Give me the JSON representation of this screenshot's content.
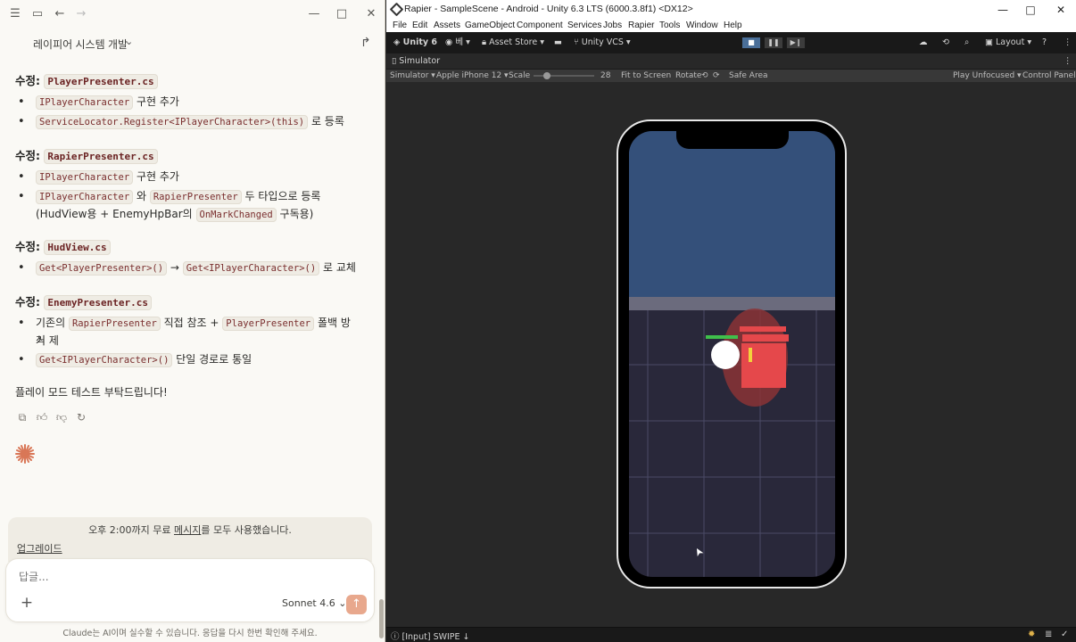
{
  "chat": {
    "title": "레이피어 시스템 개발",
    "sections": [
      {
        "prefix": "수정:",
        "file": "PlayerPresenter.cs",
        "bullets": [
          {
            "c1": "IPlayerCharacter",
            "t1": "구현 추가"
          },
          {
            "c1": "ServiceLocator.Register<IPlayerCharacter>(this)",
            "t1": "로 등록"
          }
        ]
      },
      {
        "prefix": "수정:",
        "file": "RapierPresenter.cs",
        "bullets": [
          {
            "c1": "IPlayerCharacter",
            "t1": "구현 추가"
          },
          {
            "c1": "IPlayerCharacter",
            "t1": "와",
            "c2": "RapierPresenter",
            "t2": "두 타입으로 등록",
            "line2a": "(HudView용 + EnemyHpBar의",
            "line2c": "OnMarkChanged",
            "line2b": "구독용)"
          }
        ]
      },
      {
        "prefix": "수정:",
        "file": "HudView.cs",
        "bullets": [
          {
            "c1": "Get<PlayerPresenter>()",
            "t1": "→",
            "c2": "Get<IPlayerCharacter>()",
            "t2": "로 교체"
          }
        ]
      },
      {
        "prefix": "수정:",
        "file": "EnemyPresenter.cs",
        "bullets": [
          {
            "t0": "기존의",
            "c1": "RapierPresenter",
            "t1": "직접 참조 +",
            "c2": "PlayerPresenter",
            "t2": "폴백 방식 제",
            "line2a": "거"
          },
          {
            "c1": "Get<IPlayerCharacter>()",
            "t1": "단일 경로로 통일"
          }
        ]
      }
    ],
    "closing": "플레이 모드 테스트 부탁드립니다!",
    "limit_text_a": "오후 2:00까지 무료",
    "limit_text_link": "메시지",
    "limit_text_b": "를 모두 사용했습니다.",
    "upgrade_label": "업그레이드",
    "reply_placeholder": "답글...",
    "model_label": "Sonnet 4.6",
    "disclaimer": "Claude는 AI이며 실수할 수 있습니다. 응답을 다시 한번 확인해 주세요."
  },
  "unity": {
    "window_title": "Rapier - SampleScene - Android - Unity 6.3 LTS (6000.3.8f1) <DX12>",
    "menus": [
      "File",
      "Edit",
      "Assets",
      "GameObject",
      "Component",
      "Services",
      "Jobs",
      "Rapier",
      "Tools",
      "Window",
      "Help"
    ],
    "toolbar": {
      "unity_label": "Unity 6",
      "account_label": "베",
      "asset_store": "Asset Store",
      "vcs": "Unity VCS",
      "layout": "Layout"
    },
    "tab_label": "Simulator",
    "simbar": {
      "mode": "Simulator",
      "device": "Apple iPhone 12",
      "scale_label": "Scale",
      "scale_value": "28",
      "fit": "Fit to Screen",
      "rotate": "Rotate",
      "safe_area": "Safe Area",
      "play_mode": "Play Unfocused",
      "control_panel": "Control Panel"
    },
    "status": "[Input] SWIPE ↓"
  },
  "colors": {
    "sky": "#34507a",
    "floor": "#29283a",
    "enemy": "#e5484b",
    "player": "#ffffff",
    "hp_bar": "#3fbf4b",
    "accent": "#d97757"
  }
}
